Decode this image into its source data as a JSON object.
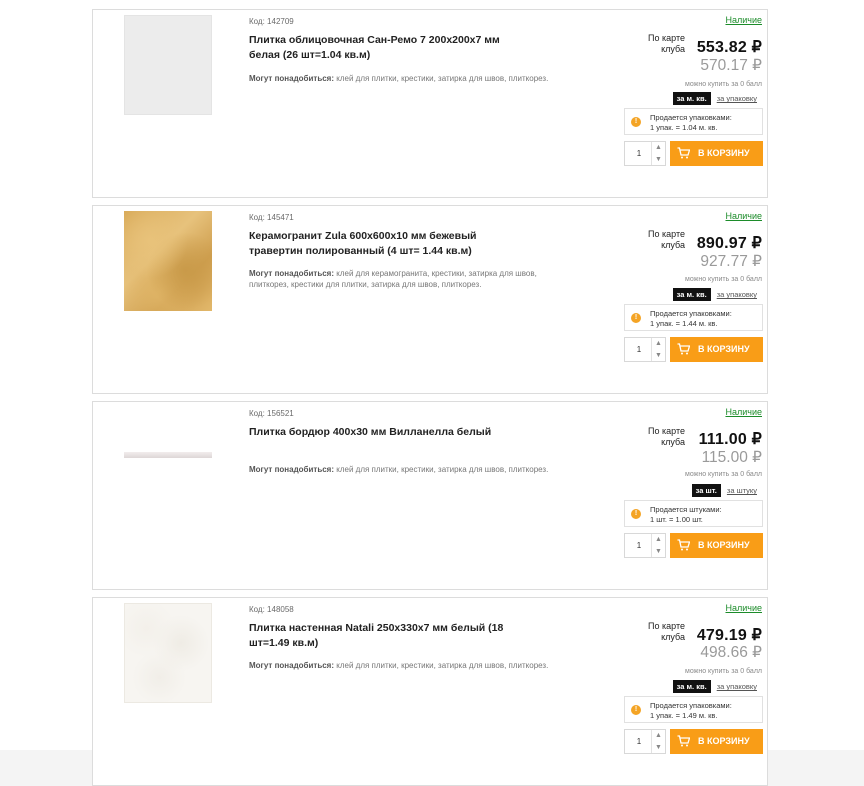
{
  "products": [
    {
      "code": "Код: 142709",
      "title": "Плитка облицовочная Сан-Ремо 7 200х200х7 мм белая (26 шт=1.04 кв.м)",
      "extras_label": "Могут понадобиться:",
      "extras_text": "клей для плитки, крестики, затирка для швов, плиткорез.",
      "availability": "Наличие",
      "club_label": "По карте клуба",
      "price_club": "553.82 ₽",
      "price_regular": "570.17 ₽",
      "bonus": "можно купить за 0 балл",
      "unit_active": "за м. кв.",
      "unit_alt": "за упаковку",
      "notice_line1": "Продается упаковками:",
      "notice_line2": "1 упак. = 1.04 м. кв.",
      "qty": "1",
      "cart_label": "В КОРЗИНУ",
      "image": "tile-white"
    },
    {
      "code": "Код: 145471",
      "title": "Керамогранит Zula 600х600х10 мм бежевый травертин полированный (4 шт= 1.44 кв.м)",
      "extras_label": "Могут понадобиться:",
      "extras_text": "клей для керамогранита, крестики, затирка для швов, плиткорез, крестики для плитки, затирка для швов, плиткорез.",
      "availability": "Наличие",
      "club_label": "По карте клуба",
      "price_club": "890.97 ₽",
      "price_regular": "927.77 ₽",
      "bonus": "можно купить за 0 балл",
      "unit_active": "за м. кв.",
      "unit_alt": "за упаковку",
      "notice_line1": "Продается упаковками:",
      "notice_line2": "1 упак. = 1.44 м. кв.",
      "qty": "1",
      "cart_label": "В КОРЗИНУ",
      "image": "tile-beige"
    },
    {
      "code": "Код: 156521",
      "title": "Плитка бордюр 400х30 мм Вилланелла белый",
      "extras_label": "Могут понадобиться:",
      "extras_text": "клей для плитки, крестики, затирка для швов, плиткорез.",
      "availability": "Наличие",
      "club_label": "По карте клуба",
      "price_club": "111.00 ₽",
      "price_regular": "115.00 ₽",
      "bonus": "можно купить за 0 балл",
      "unit_active": "за шт.",
      "unit_alt": "за штуку",
      "notice_line1": "Продается штуками:",
      "notice_line2": "1 шт. = 1.00 шт.",
      "qty": "1",
      "cart_label": "В КОРЗИНУ",
      "image": "border-strip"
    },
    {
      "code": "Код: 148058",
      "title": "Плитка настенная Natali 250х330х7 мм белый (18 шт=1.49 кв.м)",
      "extras_label": "Могут понадобиться:",
      "extras_text": "клей для плитки, крестики, затирка для швов, плиткорез.",
      "availability": "Наличие",
      "club_label": "По карте клуба",
      "price_club": "479.19 ₽",
      "price_regular": "498.66 ₽",
      "bonus": "можно купить за 0 балл",
      "unit_active": "за м. кв.",
      "unit_alt": "за упаковку",
      "notice_line1": "Продается упаковками:",
      "notice_line2": "1 упак. = 1.49 м. кв.",
      "qty": "1",
      "cart_label": "В КОРЗИНУ",
      "image": "tile-natali"
    }
  ],
  "colors": {
    "accent": "#f99d17",
    "availability": "#1c8c2a",
    "notice_icon": "#f4a425"
  }
}
